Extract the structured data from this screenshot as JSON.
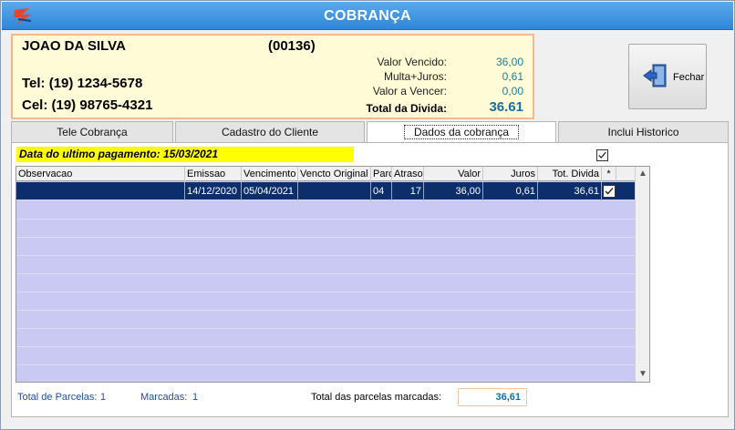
{
  "window": {
    "title": "COBRANÇA"
  },
  "client": {
    "name": "JOAO DA SILVA",
    "code": "(00136)",
    "tel": "Tel: (19) 1234-5678",
    "cel": "Cel: (19) 98765-4321"
  },
  "finance": {
    "valor_vencido_label": "Valor Vencido:",
    "valor_vencido": "36,00",
    "multa_juros_label": "Multa+Juros:",
    "multa_juros": "0,61",
    "valor_a_vencer_label": "Valor a Vencer:",
    "valor_a_vencer": "0,00",
    "total_label": "Total da Divida:",
    "total": "36.61"
  },
  "close_button": {
    "label": "Fechar",
    "icon": "exit-door-icon"
  },
  "tabs": [
    {
      "label": "Tele Cobrança",
      "active": false
    },
    {
      "label": "Cadastro do Cliente",
      "active": false
    },
    {
      "label": "Dados da cobrança",
      "active": true
    },
    {
      "label": "Inclui Historico",
      "active": false
    }
  ],
  "last_payment": "Data do ultimo pagamento: 15/03/2021",
  "grid": {
    "columns": [
      "Observacao",
      "Emissao",
      "Vencimento",
      "Vencto Original",
      "Parc",
      "Atraso",
      "Valor",
      "Juros",
      "Tot. Divida",
      "*"
    ],
    "rows": [
      {
        "observacao": "",
        "emissao": "14/12/2020",
        "vencimento": "05/04/2021",
        "vencto_original": "",
        "parc": "04",
        "atraso": "17",
        "valor": "36,00",
        "juros": "0,61",
        "tot_divida": "36,61",
        "checked": true
      }
    ]
  },
  "footer": {
    "total_parcelas_label": "Total de Parcelas:",
    "total_parcelas": "1",
    "marcadas_label": "Marcadas:",
    "marcadas": "1",
    "total_marcadas_label": "Total das parcelas marcadas:",
    "total_marcadas": "36,61"
  },
  "colors": {
    "titlebar": "#2f86d8",
    "panel_bg": "#fffbd6",
    "selected_row": "#0c2f6b",
    "grid_bg": "#c9c9f3",
    "highlight": "#ffff00"
  }
}
